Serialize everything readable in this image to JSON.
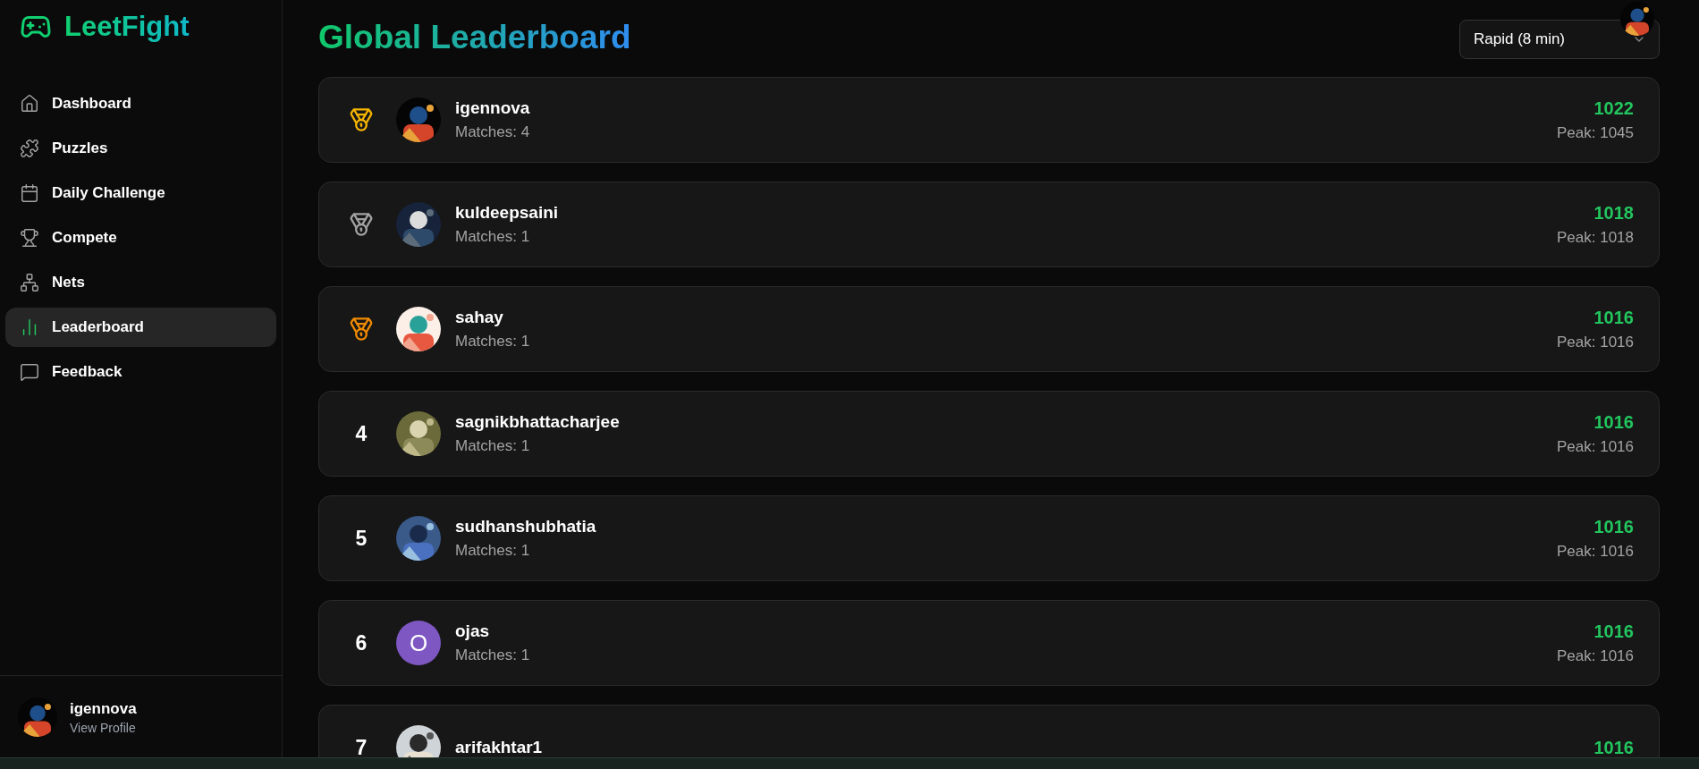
{
  "brand": {
    "name": "LeetFight"
  },
  "sidebar": {
    "items": [
      {
        "label": "Dashboard",
        "selected": false
      },
      {
        "label": "Puzzles",
        "selected": false
      },
      {
        "label": "Daily Challenge",
        "selected": false
      },
      {
        "label": "Compete",
        "selected": false
      },
      {
        "label": "Nets",
        "selected": false
      },
      {
        "label": "Leaderboard",
        "selected": true
      },
      {
        "label": "Feedback",
        "selected": false
      }
    ],
    "profile": {
      "name": "igennova",
      "link": "View Profile"
    }
  },
  "header": {
    "title": "Global Leaderboard",
    "mode_select": {
      "value": "Rapid (8 min)"
    }
  },
  "rows": [
    {
      "kind": "medal",
      "color": "#f5b400",
      "name": "igennova",
      "matches": "Matches: 4",
      "rating": "1022",
      "peak": "Peak: 1045"
    },
    {
      "kind": "medal",
      "color": "#a3a3a3",
      "name": "kuldeepsaini",
      "matches": "Matches: 1",
      "rating": "1018",
      "peak": "Peak: 1018"
    },
    {
      "kind": "medal",
      "color": "#f08a00",
      "name": "sahay",
      "matches": "Matches: 1",
      "rating": "1016",
      "peak": "Peak: 1016"
    },
    {
      "kind": "number",
      "rank": "4",
      "name": "sagnikbhattacharjee",
      "matches": "Matches: 1",
      "rating": "1016",
      "peak": "Peak: 1016"
    },
    {
      "kind": "number",
      "rank": "5",
      "name": "sudhanshubhatia",
      "matches": "Matches: 1",
      "rating": "1016",
      "peak": "Peak: 1016"
    },
    {
      "kind": "number",
      "rank": "6",
      "avatar": {
        "kind": "letter",
        "letter": "O",
        "color": "#7e57c2"
      },
      "name": "ojas",
      "matches": "Matches: 1",
      "rating": "1016",
      "peak": "Peak: 1016"
    },
    {
      "kind": "number",
      "rank": "7",
      "name": "arifakhtar1",
      "rating": "1016"
    }
  ]
}
